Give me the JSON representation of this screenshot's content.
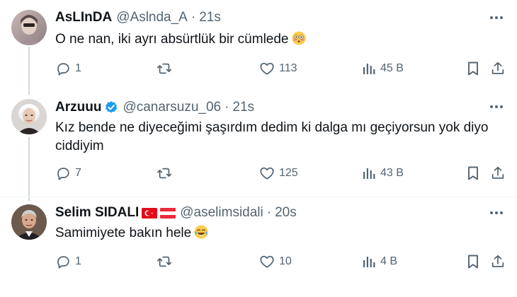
{
  "colors": {
    "text": "#0f1419",
    "muted": "#536471",
    "verified": "#1d9bf0",
    "thread_line": "#cfd9de"
  },
  "tweets": [
    {
      "name": "AsLInDA",
      "handle": "@Aslnda_A",
      "separator": "·",
      "time": "21s",
      "text": "O ne nan, iki ayrı absürtlük bir cümlede",
      "emoji": "flushed-face",
      "replies": "1",
      "likes": "113",
      "views": "45 B"
    },
    {
      "name": "Arzuuu",
      "verified": true,
      "handle": "@canarsuzu_06",
      "separator": "·",
      "time": "21s",
      "text_line1": "Kız bende ne diyeceğimi şaşırdım dedim ki dalga mı geçiyorsun yok diyo",
      "text_line2": "ciddiyim",
      "replies": "7",
      "likes": "125",
      "views": "43 B"
    },
    {
      "name": "Selim SIDALI",
      "flags": [
        "turkey-flag",
        "austria-flag"
      ],
      "handle": "@aselimsidali",
      "separator": "·",
      "time": "20s",
      "text": "Samimiyete bakın hele",
      "emoji": "tears-of-joy-face",
      "replies": "1",
      "likes": "10",
      "views": "4 B"
    }
  ]
}
